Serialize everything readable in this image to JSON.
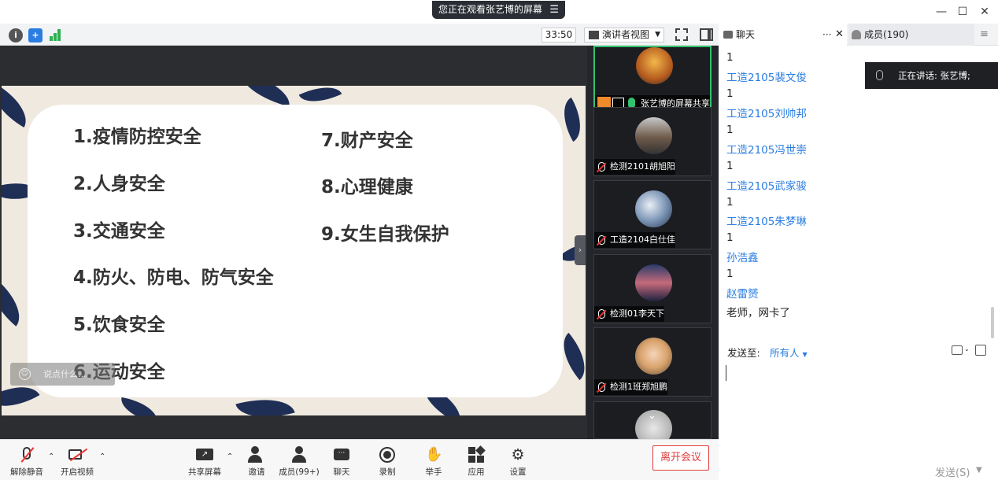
{
  "banner": {
    "text": "您正在观看张艺博的屏幕",
    "menu_icon": "menu-icon"
  },
  "window": {
    "minimize": "—",
    "maximize": "☐",
    "close": "✕"
  },
  "toolbar": {
    "timer": "33:50",
    "view_mode": "演讲者视图"
  },
  "slide": {
    "items_left": [
      "1.疫情防控安全",
      "2.人身安全",
      "3.交通安全",
      "4.防火、防电、防气安全",
      "5.饮食安全",
      "6.运动安全"
    ],
    "items_right": [
      "7.财产安全",
      "8.心理健康",
      "9.女生自我保护"
    ],
    "say_placeholder": "说点什么..."
  },
  "videos": [
    {
      "name": "张艺博的屏幕共享",
      "active": true
    },
    {
      "name": "检测2101胡旭阳"
    },
    {
      "name": "工造2104白仕佳"
    },
    {
      "name": "检测01李天下"
    },
    {
      "name": "检测1班郑旭鹏"
    }
  ],
  "bottom": {
    "unmute": "解除静音",
    "video": "开启视频",
    "share": "共享屏幕",
    "invite": "邀请",
    "members": "成员(99+)",
    "chat": "聊天",
    "record": "录制",
    "raise_hand": "举手",
    "apps": "应用",
    "settings": "设置",
    "leave": "离开会议"
  },
  "chat": {
    "tab_chat": "聊天",
    "tab_more": "···",
    "tab_close": "✕",
    "tab_members": "成员(190)",
    "speaking": "正在讲话: 张艺博;",
    "messages": [
      "1",
      "工造2105裴文俊",
      "1",
      "工造2105刘帅邦",
      "1",
      "工造2105冯世崇",
      "1",
      "工造2105武家骏",
      "1",
      "工造2105朱梦琳",
      "1",
      "孙浩鑫",
      "1",
      "赵雷赟",
      "老师，网卡了"
    ],
    "send_to_label": "发送至:",
    "send_to_value": "所有人",
    "send_button": "发送(S)"
  },
  "colors": {
    "accent": "#2a7de1",
    "leave": "#e03c3c",
    "active_border": "#33c26f",
    "slide_navy": "#1f2e55"
  }
}
